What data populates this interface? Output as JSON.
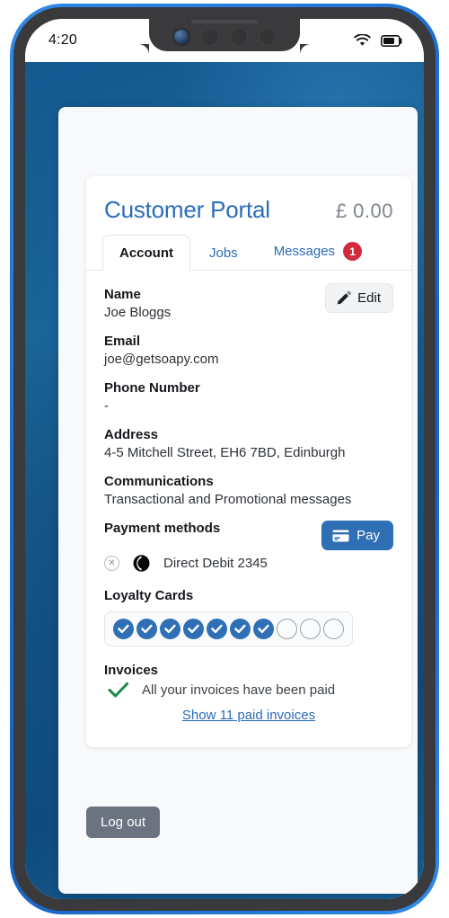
{
  "status_bar": {
    "time": "4:20",
    "wifi_icon": "wifi-icon",
    "battery_icon": "battery-icon"
  },
  "portal": {
    "title": "Customer Portal",
    "balance": "£ 0.00"
  },
  "tabs": [
    {
      "label": "Account",
      "active": true,
      "badge": null
    },
    {
      "label": "Jobs",
      "active": false,
      "badge": null
    },
    {
      "label": "Messages",
      "active": false,
      "badge": "1"
    }
  ],
  "edit_button": {
    "label": "Edit",
    "icon": "pencil-icon"
  },
  "fields": [
    {
      "label": "Name",
      "value": "Joe Bloggs"
    },
    {
      "label": "Email",
      "value": "joe@getsoapy.com"
    },
    {
      "label": "Phone Number",
      "value": "-"
    },
    {
      "label": "Address",
      "value": "4-5 Mitchell Street, EH6 7BD, Edinburgh"
    },
    {
      "label": "Communications",
      "value": "Transactional and Promotional messages"
    }
  ],
  "payment": {
    "heading": "Payment methods",
    "pay_button_label": "Pay",
    "pay_button_icon": "credit-card-icon",
    "remove_icon": "remove-circle-icon",
    "method_icon": "direct-debit-logo",
    "method_label": "Direct Debit 2345"
  },
  "loyalty": {
    "heading": "Loyalty Cards",
    "filled_count": 7,
    "empty_count": 3,
    "stamp_icon": "check-icon"
  },
  "invoices": {
    "heading": "Invoices",
    "status_icon": "green-check-icon",
    "status_text": "All your invoices have been paid",
    "link_label": "Show 11 paid invoices"
  },
  "logout": {
    "label": "Log out"
  },
  "colors": {
    "brand_blue": "#2b6cb8",
    "button_blue": "#2f6fb5",
    "badge_red": "#d32b3e",
    "check_green": "#1f8a4c",
    "logout_gray": "#6b7280",
    "app_background": "#14598f"
  }
}
